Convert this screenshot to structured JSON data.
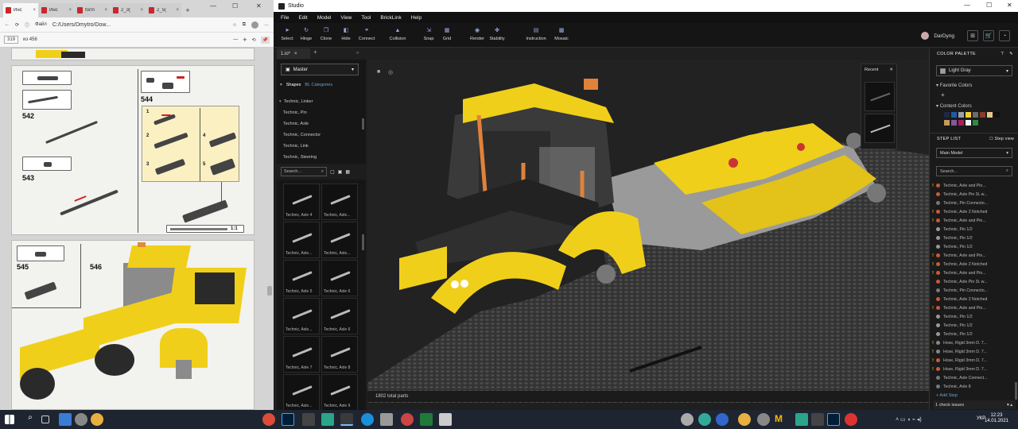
{
  "browser": {
    "tabs": [
      {
        "label": "Инс"
      },
      {
        "label": "Инс"
      },
      {
        "label": "form"
      },
      {
        "label": "2_3("
      },
      {
        "label": "2_5("
      }
    ],
    "new_tab": "+",
    "address_prefix": "Файл",
    "address": "C:/Users/Dmytro/Dow...",
    "page_number": "319",
    "page_total": "из 456"
  },
  "manual": {
    "steps": [
      "542",
      "543",
      "544",
      "545",
      "546"
    ],
    "substeps": [
      "1",
      "2",
      "3",
      "4",
      "5"
    ],
    "scale": "1:1"
  },
  "studio": {
    "window_title": "Studio",
    "menu": [
      "File",
      "Edit",
      "Model",
      "View",
      "Tool",
      "BrickLink",
      "Help"
    ],
    "tools": [
      "Select",
      "Hinge",
      "Clone",
      "Hide",
      "Connect",
      "Collision",
      "Snap",
      "Grid",
      "Render",
      "Stability",
      "Instruction",
      "Mosaic"
    ],
    "user": "DarDyng",
    "doc_tab": "1.io*",
    "parts_panel": {
      "master": "Master",
      "tabs": [
        "Shapes",
        "BL Categories"
      ],
      "categories": [
        "Technic, Linker",
        "Technic, Pin",
        "Technic, Axle",
        "Technic, Connector",
        "Technic, Link",
        "Technic, Steering"
      ],
      "search_placeholder": "Search...",
      "items": [
        "Technic, Axle 4",
        "Technic, Axle...",
        "Technic, Axle...",
        "Technic, Axle...",
        "Technic, Axle 5",
        "Technic, Axle 6",
        "Technic, Axle...",
        "Technic, Axle 6",
        "Technic, Axle 7",
        "Technic, Axle 8",
        "Technic, Axle...",
        "Technic, Axle 9"
      ]
    },
    "recent": "Recent",
    "total_parts": "1802 total parts",
    "color_palette": {
      "header": "COLOR PALETTE",
      "selected": "Light Gray",
      "favorite": "Favorite Colors",
      "content": "Content Colors",
      "content_swatches": [
        "#1b2a44",
        "#1e5aa8",
        "#9aa0a6",
        "#f2cd37",
        "#6b6b6b",
        "#8a3b2a",
        "#e7c78e",
        "#111111",
        "#c89a5a",
        "#7e5a9b",
        "#a81f5a",
        "#f4f4f4",
        "#2e8b3e"
      ]
    },
    "step_list": {
      "header": "STEP LIST",
      "step_view": "Step view",
      "model": "Main Model",
      "search_placeholder": "Search...",
      "rows": [
        {
          "label": "Technic, Axle and Pin...",
          "warn": true,
          "color": "#c85a3a"
        },
        {
          "label": "Technic, Axle Pin 3L w...",
          "warn": false,
          "color": "#c85a3a"
        },
        {
          "label": "Technic, Pin Connecto...",
          "warn": false,
          "color": "#777"
        },
        {
          "label": "Technic, Axle 2 Notched",
          "warn": true,
          "color": "#c85a3a"
        },
        {
          "label": "Technic, Axle and Pin...",
          "warn": true,
          "color": "#c85a3a"
        },
        {
          "label": "Technic, Pin 1/2",
          "warn": false,
          "color": "#999"
        },
        {
          "label": "Technic, Pin 1/2",
          "warn": false,
          "color": "#999"
        },
        {
          "label": "Technic, Pin 1/2",
          "warn": false,
          "color": "#999"
        },
        {
          "label": "Technic, Axle and Pin...",
          "warn": true,
          "color": "#c85a3a"
        },
        {
          "label": "Technic, Axle 2 Notched",
          "warn": true,
          "color": "#c85a3a"
        },
        {
          "label": "Technic, Axle and Pin...",
          "warn": true,
          "color": "#c85a3a"
        },
        {
          "label": "Technic, Axle Pin 3L w...",
          "warn": false,
          "color": "#c85a3a"
        },
        {
          "label": "Technic, Pin Connecto...",
          "warn": false,
          "color": "#777"
        },
        {
          "label": "Technic, Axle 2 Notched",
          "warn": false,
          "color": "#c85a3a"
        },
        {
          "label": "Technic, Axle and Pin...",
          "warn": true,
          "color": "#c85a3a"
        },
        {
          "label": "Technic, Pin 1/2",
          "warn": false,
          "color": "#999"
        },
        {
          "label": "Technic, Pin 1/2",
          "warn": false,
          "color": "#999"
        },
        {
          "label": "Technic, Pin 1/2",
          "warn": false,
          "color": "#999"
        },
        {
          "label": "Hose, Rigid 3mm D.  7...",
          "warn": true,
          "color": "#888"
        },
        {
          "label": "Hose, Rigid 3mm D.  7...",
          "warn": true,
          "color": "#888"
        },
        {
          "label": "Hose, Rigid 3mm D.  7...",
          "warn": true,
          "color": "#c85a3a"
        },
        {
          "label": "Hose, Rigid 3mm D.  7...",
          "warn": true,
          "color": "#c85a3a"
        },
        {
          "label": "Technic, Axle Connect...",
          "warn": false,
          "color": "#777"
        },
        {
          "label": "Technic, Axle 8",
          "warn": false,
          "color": "#777"
        }
      ],
      "add_step": "+ Add Step",
      "check_issues": "1  check issues"
    }
  },
  "taskbar": {
    "lang": "УКР",
    "time": "12:23",
    "date": "14.01.2021"
  }
}
